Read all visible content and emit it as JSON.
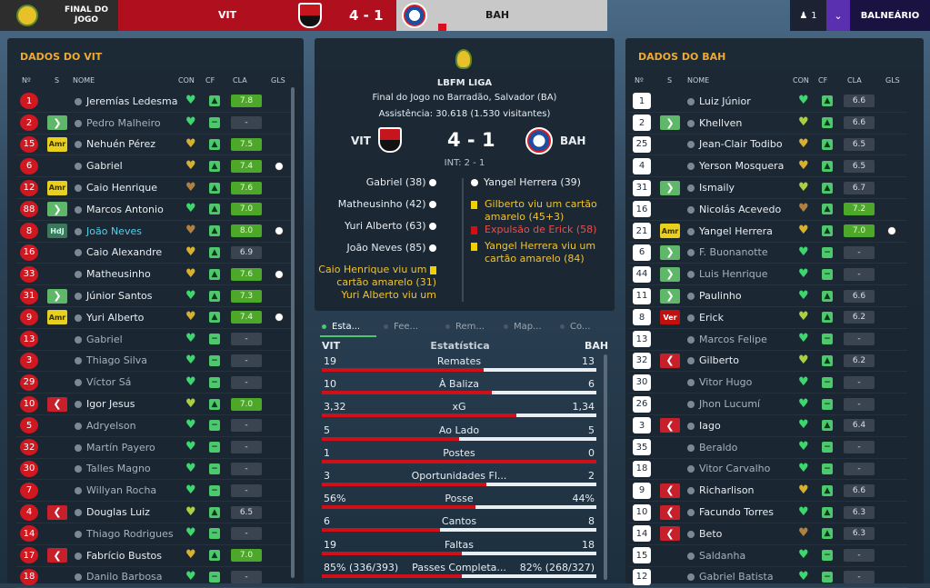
{
  "header": {
    "stage_line1": "FINAL DO",
    "stage_line2": "JOGO",
    "home": "VIT",
    "score": "4 - 1",
    "away": "BAH",
    "user_count": "1",
    "save_name": "BALNEÁRIO"
  },
  "left": {
    "title": "DADOS DO VIT",
    "cols": {
      "n": "Nº",
      "s": "S",
      "name": "NOME",
      "con": "CON",
      "cf": "CF",
      "cla": "CLA",
      "gls": "GLS"
    },
    "players": [
      {
        "n": "1",
        "s": "",
        "name": "Jeremías Ledesma",
        "h": "g",
        "r": "7.8",
        "gl": ""
      },
      {
        "n": "2",
        "s": ">",
        "name": "Pedro Malheiro",
        "h": "g",
        "r": "-",
        "gl": ""
      },
      {
        "n": "15",
        "s": "Amr",
        "name": "Nehuén Pérez",
        "h": "y",
        "r": "7.5",
        "gl": ""
      },
      {
        "n": "6",
        "s": "",
        "name": "Gabriel",
        "h": "y",
        "r": "7.4",
        "gl": "1"
      },
      {
        "n": "12",
        "s": "Amr",
        "name": "Caio Henrique",
        "h": "b",
        "r": "7.6",
        "gl": ""
      },
      {
        "n": "88",
        "s": ">",
        "name": "Marcos Antonio",
        "h": "g",
        "r": "7.0",
        "gl": ""
      },
      {
        "n": "8",
        "s": "HdJ",
        "name": "João Neves",
        "h": "b",
        "r": "8.0",
        "gl": "1"
      },
      {
        "n": "16",
        "s": "",
        "name": "Caio Alexandre",
        "h": "y",
        "r": "6.9",
        "gl": ""
      },
      {
        "n": "33",
        "s": "",
        "name": "Matheusinho",
        "h": "y",
        "r": "7.6",
        "gl": "1"
      },
      {
        "n": "31",
        "s": ">",
        "name": "Júnior Santos",
        "h": "g",
        "r": "7.3",
        "gl": ""
      },
      {
        "n": "9",
        "s": "Amr",
        "name": "Yuri Alberto",
        "h": "y",
        "r": "7.4",
        "gl": "1"
      },
      {
        "n": "13",
        "s": "",
        "name": "Gabriel",
        "h": "g",
        "r": "-",
        "gl": ""
      },
      {
        "n": "3",
        "s": "",
        "name": "Thiago Silva",
        "h": "g",
        "r": "-",
        "gl": ""
      },
      {
        "n": "29",
        "s": "",
        "name": "Víctor Sá",
        "h": "g",
        "r": "-",
        "gl": ""
      },
      {
        "n": "10",
        "s": "<",
        "name": "Igor Jesus",
        "h": "l",
        "r": "7.0",
        "gl": ""
      },
      {
        "n": "5",
        "s": "",
        "name": "Adryelson",
        "h": "g",
        "r": "-",
        "gl": ""
      },
      {
        "n": "32",
        "s": "",
        "name": "Martín Payero",
        "h": "g",
        "r": "-",
        "gl": ""
      },
      {
        "n": "30",
        "s": "",
        "name": "Talles Magno",
        "h": "g",
        "r": "-",
        "gl": ""
      },
      {
        "n": "7",
        "s": "",
        "name": "Willyan Rocha",
        "h": "g",
        "r": "-",
        "gl": ""
      },
      {
        "n": "4",
        "s": "<",
        "name": "Douglas Luiz",
        "h": "l",
        "r": "6.5",
        "gl": ""
      },
      {
        "n": "14",
        "s": "",
        "name": "Thiago Rodrigues",
        "h": "g",
        "r": "-",
        "gl": ""
      },
      {
        "n": "17",
        "s": "<",
        "name": "Fabrício Bustos",
        "h": "y",
        "r": "7.0",
        "gl": ""
      },
      {
        "n": "18",
        "s": "",
        "name": "Danilo Barbosa",
        "h": "g",
        "r": "-",
        "gl": ""
      }
    ]
  },
  "right": {
    "title": "DADOS DO BAH",
    "cols": {
      "n": "Nº",
      "s": "S",
      "name": "NOME",
      "con": "CON",
      "cf": "CF",
      "cla": "CLA",
      "gls": "GLS"
    },
    "players": [
      {
        "n": "1",
        "s": "",
        "name": "Luiz Júnior",
        "h": "g",
        "r": "6.6",
        "gl": ""
      },
      {
        "n": "2",
        "s": ">",
        "name": "Khellven",
        "h": "l",
        "r": "6.6",
        "gl": ""
      },
      {
        "n": "25",
        "s": "",
        "name": "Jean-Clair Todibo",
        "h": "y",
        "r": "6.5",
        "gl": ""
      },
      {
        "n": "4",
        "s": "",
        "name": "Yerson Mosquera",
        "h": "y",
        "r": "6.5",
        "gl": ""
      },
      {
        "n": "31",
        "s": ">",
        "name": "Ismaily",
        "h": "l",
        "r": "6.7",
        "gl": ""
      },
      {
        "n": "16",
        "s": "",
        "name": "Nicolás Acevedo",
        "h": "b",
        "r": "7.2",
        "gl": ""
      },
      {
        "n": "21",
        "s": "Amr",
        "name": "Yangel Herrera",
        "h": "y",
        "r": "7.0",
        "gl": "1"
      },
      {
        "n": "6",
        "s": ">",
        "name": "F. Buonanotte",
        "h": "g",
        "r": "-",
        "gl": ""
      },
      {
        "n": "44",
        "s": ">",
        "name": "Luis Henrique",
        "h": "g",
        "r": "-",
        "gl": ""
      },
      {
        "n": "11",
        "s": ">",
        "name": "Paulinho",
        "h": "g",
        "r": "6.6",
        "gl": ""
      },
      {
        "n": "8",
        "s": "Ver",
        "name": "Erick",
        "h": "l",
        "r": "6.2",
        "gl": ""
      },
      {
        "n": "13",
        "s": "",
        "name": "Marcos Felipe",
        "h": "g",
        "r": "-",
        "gl": ""
      },
      {
        "n": "32",
        "s": "<",
        "name": "Gilberto",
        "h": "l",
        "r": "6.2",
        "gl": ""
      },
      {
        "n": "30",
        "s": "",
        "name": "Vitor Hugo",
        "h": "g",
        "r": "-",
        "gl": ""
      },
      {
        "n": "26",
        "s": "",
        "name": "Jhon Lucumí",
        "h": "g",
        "r": "-",
        "gl": ""
      },
      {
        "n": "3",
        "s": "<",
        "name": "Iago",
        "h": "g",
        "r": "6.4",
        "gl": ""
      },
      {
        "n": "35",
        "s": "",
        "name": "Beraldo",
        "h": "g",
        "r": "-",
        "gl": ""
      },
      {
        "n": "18",
        "s": "",
        "name": "Vitor Carvalho",
        "h": "g",
        "r": "-",
        "gl": ""
      },
      {
        "n": "9",
        "s": "<",
        "name": "Richarlison",
        "h": "y",
        "r": "6.6",
        "gl": ""
      },
      {
        "n": "10",
        "s": "<",
        "name": "Facundo Torres",
        "h": "g",
        "r": "6.3",
        "gl": ""
      },
      {
        "n": "14",
        "s": "<",
        "name": "Beto",
        "h": "b",
        "r": "6.3",
        "gl": ""
      },
      {
        "n": "15",
        "s": "",
        "name": "Saldanha",
        "h": "g",
        "r": "-",
        "gl": ""
      },
      {
        "n": "12",
        "s": "",
        "name": "Gabriel Batista",
        "h": "g",
        "r": "-",
        "gl": ""
      }
    ]
  },
  "match": {
    "league": "LBFM LIGA",
    "venue": "Final do Jogo no Barradão, Salvador (BA)",
    "attendance": "Assistência: 30.618 (1.530 visitantes)",
    "home": "VIT",
    "away": "BAH",
    "score": "4 - 1",
    "ht": "INT: 2 - 1",
    "home_events": [
      "Gabriel (38)",
      "Matheusinho (42)",
      "Yuri Alberto (63)",
      "João Neves (85)",
      "Caio Henrique viu um",
      "cartão amarelo (31)",
      "Yuri Alberto viu um"
    ],
    "away_events": [
      "Yangel Herrera (39)",
      "Gilberto viu um cartão",
      "amarelo (45+3)",
      "Expulsão de Erick (58)",
      "Yangel Herrera viu um",
      "cartão amarelo (84)"
    ]
  },
  "tabs": [
    "Esta...",
    "Fee...",
    "Rem...",
    "Map...",
    "Co..."
  ],
  "stats": {
    "home": "VIT",
    "away": "BAH",
    "title": "Estatística",
    "rows": [
      {
        "l": "19",
        "c": "Remates",
        "r": "13",
        "f": 0.59
      },
      {
        "l": "10",
        "c": "À Baliza",
        "r": "6",
        "f": 0.62
      },
      {
        "l": "3,32",
        "c": "xG",
        "r": "1,34",
        "f": 0.71
      },
      {
        "l": "5",
        "c": "Ao Lado",
        "r": "5",
        "f": 0.5
      },
      {
        "l": "1",
        "c": "Postes",
        "r": "0",
        "f": 1
      },
      {
        "l": "3",
        "c": "Oportunidades Fl...",
        "r": "2",
        "f": 0.6
      },
      {
        "l": "56%",
        "c": "Posse",
        "r": "44%",
        "f": 0.56
      },
      {
        "l": "6",
        "c": "Cantos",
        "r": "8",
        "f": 0.43
      },
      {
        "l": "19",
        "c": "Faltas",
        "r": "18",
        "f": 0.51
      },
      {
        "l": "85% (336/393)",
        "c": "Passes Completa...",
        "r": "82% (268/327)",
        "f": 0.51
      }
    ]
  }
}
